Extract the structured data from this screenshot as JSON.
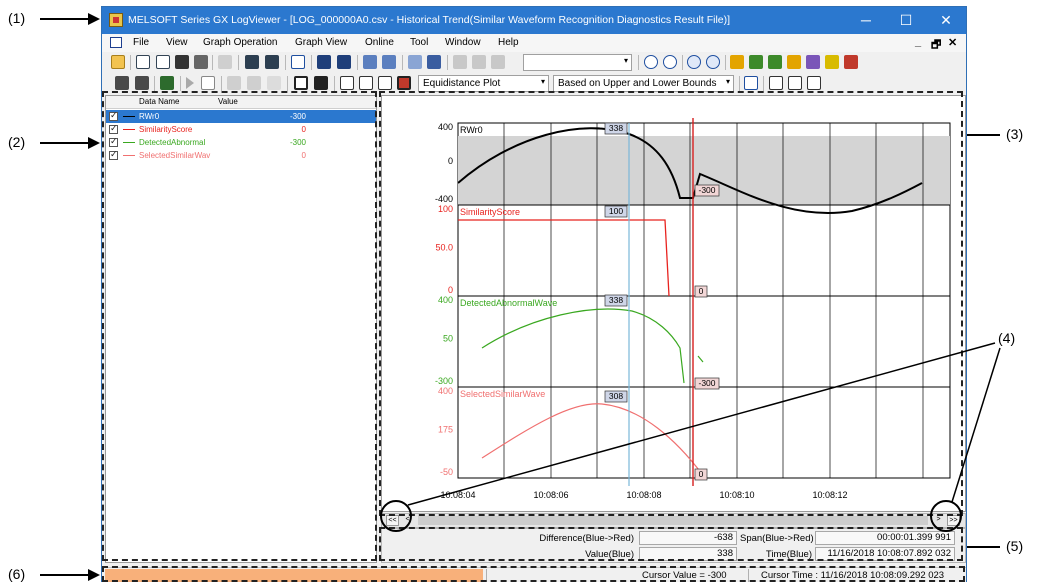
{
  "callouts": [
    "(1)",
    "(2)",
    "(3)",
    "(4)",
    "(5)",
    "(6)"
  ],
  "window": {
    "title": "MELSOFT Series GX LogViewer - [LOG_000000A0.csv - Historical Trend(Similar Waveform Recognition Diagnostics Result File)]",
    "buttons": {
      "minimize": "─",
      "maximize": "☐",
      "close": "✕"
    }
  },
  "menu": {
    "items": [
      "File",
      "View",
      "Graph Operation",
      "Graph View",
      "Online",
      "Tool",
      "Window",
      "Help"
    ],
    "mdi_controls": [
      "_",
      "🗗",
      "✕"
    ]
  },
  "toolbar": {
    "plot_mode": "Equidistance Plot",
    "bounds_mode": "Based on Upper and Lower Bounds",
    "empty_combo": ""
  },
  "data_list": {
    "headers": {
      "name": "Data Name",
      "value": "Value"
    },
    "rows": [
      {
        "name": "RWr0",
        "value": "-300",
        "color": "#000000",
        "selected": true
      },
      {
        "name": "SimilarityScore",
        "value": "0",
        "color": "#e8231f",
        "selected": false
      },
      {
        "name": "DetectedAbnormal",
        "value": "-300",
        "color": "#3aa820",
        "selected": false
      },
      {
        "name": "SelectedSimilarWav",
        "value": "0",
        "color": "#f07070",
        "selected": false
      }
    ]
  },
  "graph": {
    "cursor_blue_time": "10:08:07.892",
    "cursor_red_time": "10:08:09.292",
    "time_ticks": [
      "10:08:04",
      "10:08:06",
      "10:08:08",
      "10:08:10",
      "10:08:12"
    ],
    "panes": [
      {
        "name": "RWr0",
        "color": "#000000",
        "y_labels": [
          "400",
          "0",
          "-400"
        ],
        "blue_value": "338",
        "red_value": "-300"
      },
      {
        "name": "SimilarityScore",
        "color": "#e8231f",
        "y_labels": [
          "100",
          "50.0",
          "0"
        ],
        "blue_value": "100",
        "red_value": "0"
      },
      {
        "name": "DetectedAbnormalWave",
        "color": "#3aa820",
        "y_labels": [
          "400",
          "50",
          "-300"
        ],
        "blue_value": "338",
        "red_value": "-300"
      },
      {
        "name": "SelectedSimilarWave",
        "color": "#f07070",
        "y_labels": [
          "400",
          "175",
          "-50"
        ],
        "blue_value": "308",
        "red_value": "0"
      }
    ]
  },
  "scrollbar": {
    "left_end": "<<",
    "left": "<",
    "right": ">",
    "right_end": ">>"
  },
  "info": {
    "difference_label": "Difference(Blue->Red)",
    "difference_value": "-638",
    "span_label": "Span(Blue->Red)",
    "span_value": "00:00:01.399 991",
    "value_label": "Value(Blue)",
    "value_value": "338",
    "time_label": "Time(Blue)",
    "time_value": "11/16/2018 10:08:07.892 032"
  },
  "status": {
    "cursor_value": "Cursor Value = -300",
    "cursor_time": "Cursor Time : 11/16/2018 10:08:09.292 023"
  }
}
